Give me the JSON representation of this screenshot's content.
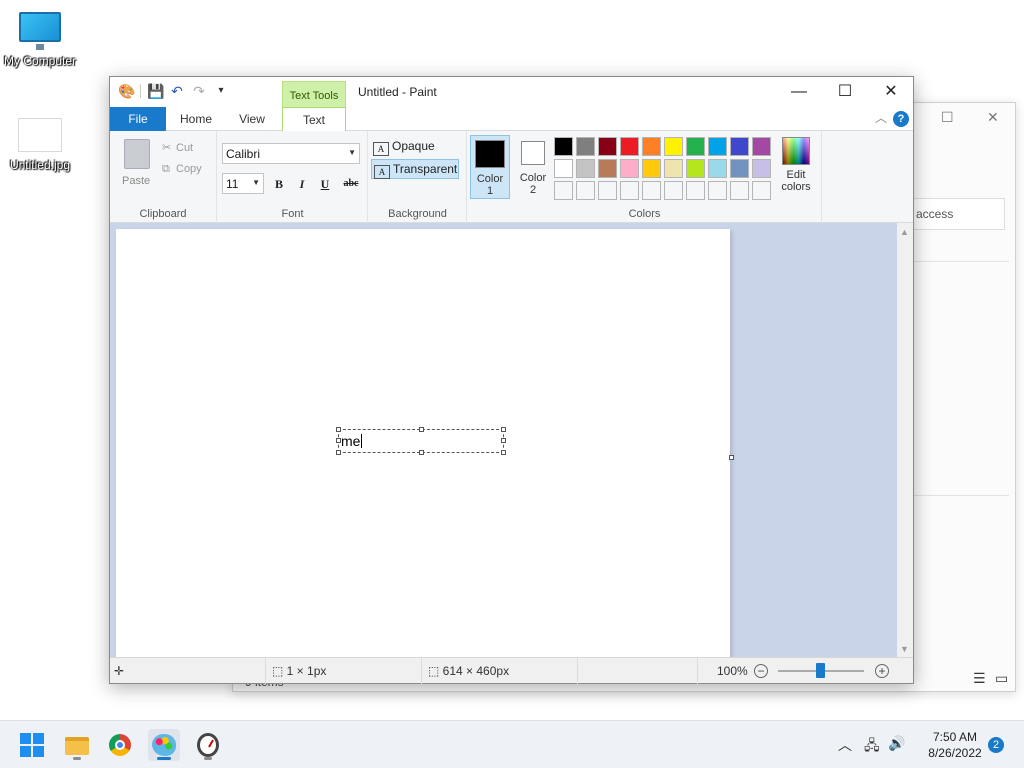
{
  "desktop": {
    "icons": [
      {
        "label": "My Computer"
      },
      {
        "label": "Untitled.jpg"
      }
    ]
  },
  "explorer": {
    "search_label": "access",
    "status_items": "9 items"
  },
  "paint": {
    "title": "Untitled - Paint",
    "context_tab": "Text Tools",
    "tabs": {
      "file": "File",
      "home": "Home",
      "view": "View",
      "text": "Text"
    },
    "clipboard": {
      "paste": "Paste",
      "cut": "Cut",
      "copy": "Copy",
      "label": "Clipboard"
    },
    "font": {
      "family": "Calibri",
      "size": "11",
      "bold": "B",
      "italic": "I",
      "underline": "U",
      "strike": "abc",
      "label": "Font"
    },
    "background": {
      "opaque": "Opaque",
      "transparent": "Transparent",
      "label": "Background",
      "selected": "transparent"
    },
    "colors": {
      "color1_label": "Color",
      "color1_num": "1",
      "color2_label": "Color",
      "color2_num": "2",
      "color1": "#000000",
      "color2": "#ffffff",
      "edit_label": "Edit",
      "edit_label2": "colors",
      "label": "Colors",
      "palette_row1": [
        "#000000",
        "#7f7f7f",
        "#880015",
        "#ed1c24",
        "#ff7f27",
        "#fff200",
        "#22b14c",
        "#00a2e8",
        "#3f48cc",
        "#a349a4"
      ],
      "palette_row2": [
        "#ffffff",
        "#c3c3c3",
        "#b97a57",
        "#ffaec9",
        "#ffc90e",
        "#efe4b0",
        "#b5e61d",
        "#99d9ea",
        "#7092be",
        "#c8bfe7"
      ]
    },
    "canvas_text": "me",
    "status": {
      "selection": "1 × 1px",
      "size": "614 × 460px",
      "zoom": "100%"
    }
  },
  "taskbar": {
    "time": "7:50 AM",
    "date": "8/26/2022",
    "notifications": "2"
  }
}
